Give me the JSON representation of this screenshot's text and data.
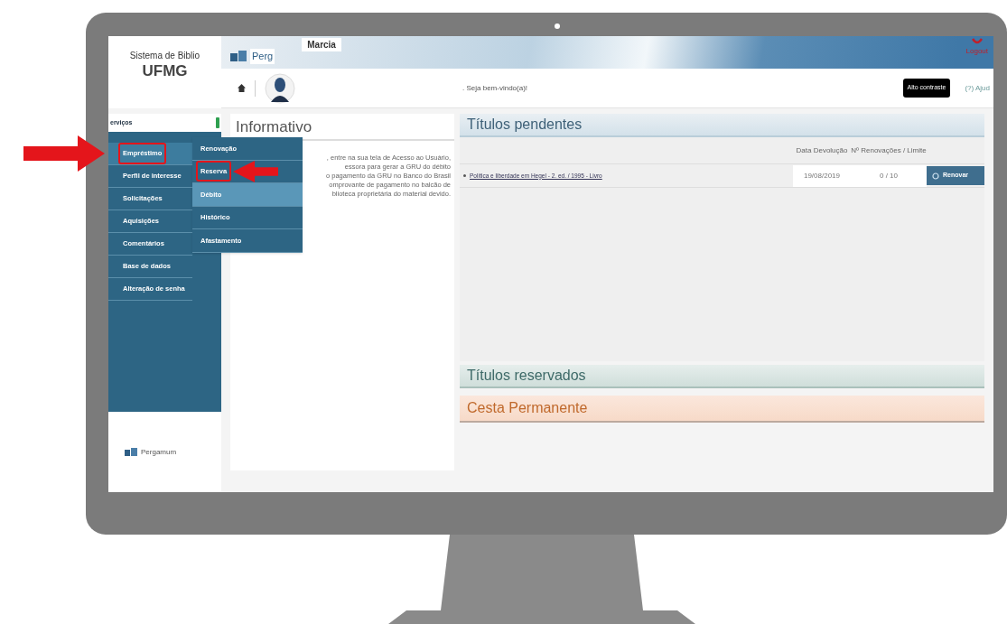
{
  "header": {
    "system_name": "Sistema de Biblio",
    "institution": "UFMG",
    "logo_text": "Perg",
    "user_name": "Marcia",
    "logout": "Logout",
    "welcome": ". Seja bem-vindo(a)!",
    "contrast_button": "Alto contraste",
    "help": "(?) Ajud"
  },
  "sidebar": {
    "title": "erviços",
    "items": [
      {
        "label": "Empréstimo",
        "selected": true,
        "highlighted": true,
        "arrow": true
      },
      {
        "label": "Perfil de interesse",
        "selected": false,
        "highlighted": false
      },
      {
        "label": "Solicitações",
        "selected": false,
        "highlighted": false
      },
      {
        "label": "Aquisições",
        "selected": false,
        "highlighted": false
      },
      {
        "label": "Comentários",
        "selected": false,
        "highlighted": false
      },
      {
        "label": "Base de dados",
        "selected": false,
        "highlighted": false
      },
      {
        "label": "Alteração de senha",
        "selected": false,
        "highlighted": false
      }
    ],
    "footer_logo": "Pergamum"
  },
  "submenu": {
    "items": [
      {
        "label": "Renovação",
        "selected": false,
        "highlighted": false
      },
      {
        "label": "Reserva",
        "selected": false,
        "highlighted": true,
        "arrow": true
      },
      {
        "label": "Débito",
        "selected": true,
        "highlighted": false
      },
      {
        "label": "Histórico",
        "selected": false,
        "highlighted": false
      },
      {
        "label": "Afastamento",
        "selected": false,
        "highlighted": false
      }
    ]
  },
  "informativo": {
    "title": "Informativo",
    "lines": [
      ", entre na sua tela de Acesso ao Usuário,",
      "essora para gerar a GRU do débito",
      "o pagamento da GRU no Banco do Brasil",
      "omprovante de pagamento no balcão de",
      "blioteca proprietária do material devido."
    ]
  },
  "pending": {
    "title": "Títulos pendentes",
    "columns": [
      "Data Devolução",
      "Nº Renovações / Limite"
    ],
    "rows": [
      {
        "title": "Política e liberdade em Hegel - 2. ed. / 1995 - Livro",
        "due_date": "19/08/2019",
        "renewals": "0 / 10",
        "action": "Renovar"
      }
    ]
  },
  "reserved": {
    "title": "Títulos reservados"
  },
  "basket": {
    "title": "Cesta Permanente"
  }
}
